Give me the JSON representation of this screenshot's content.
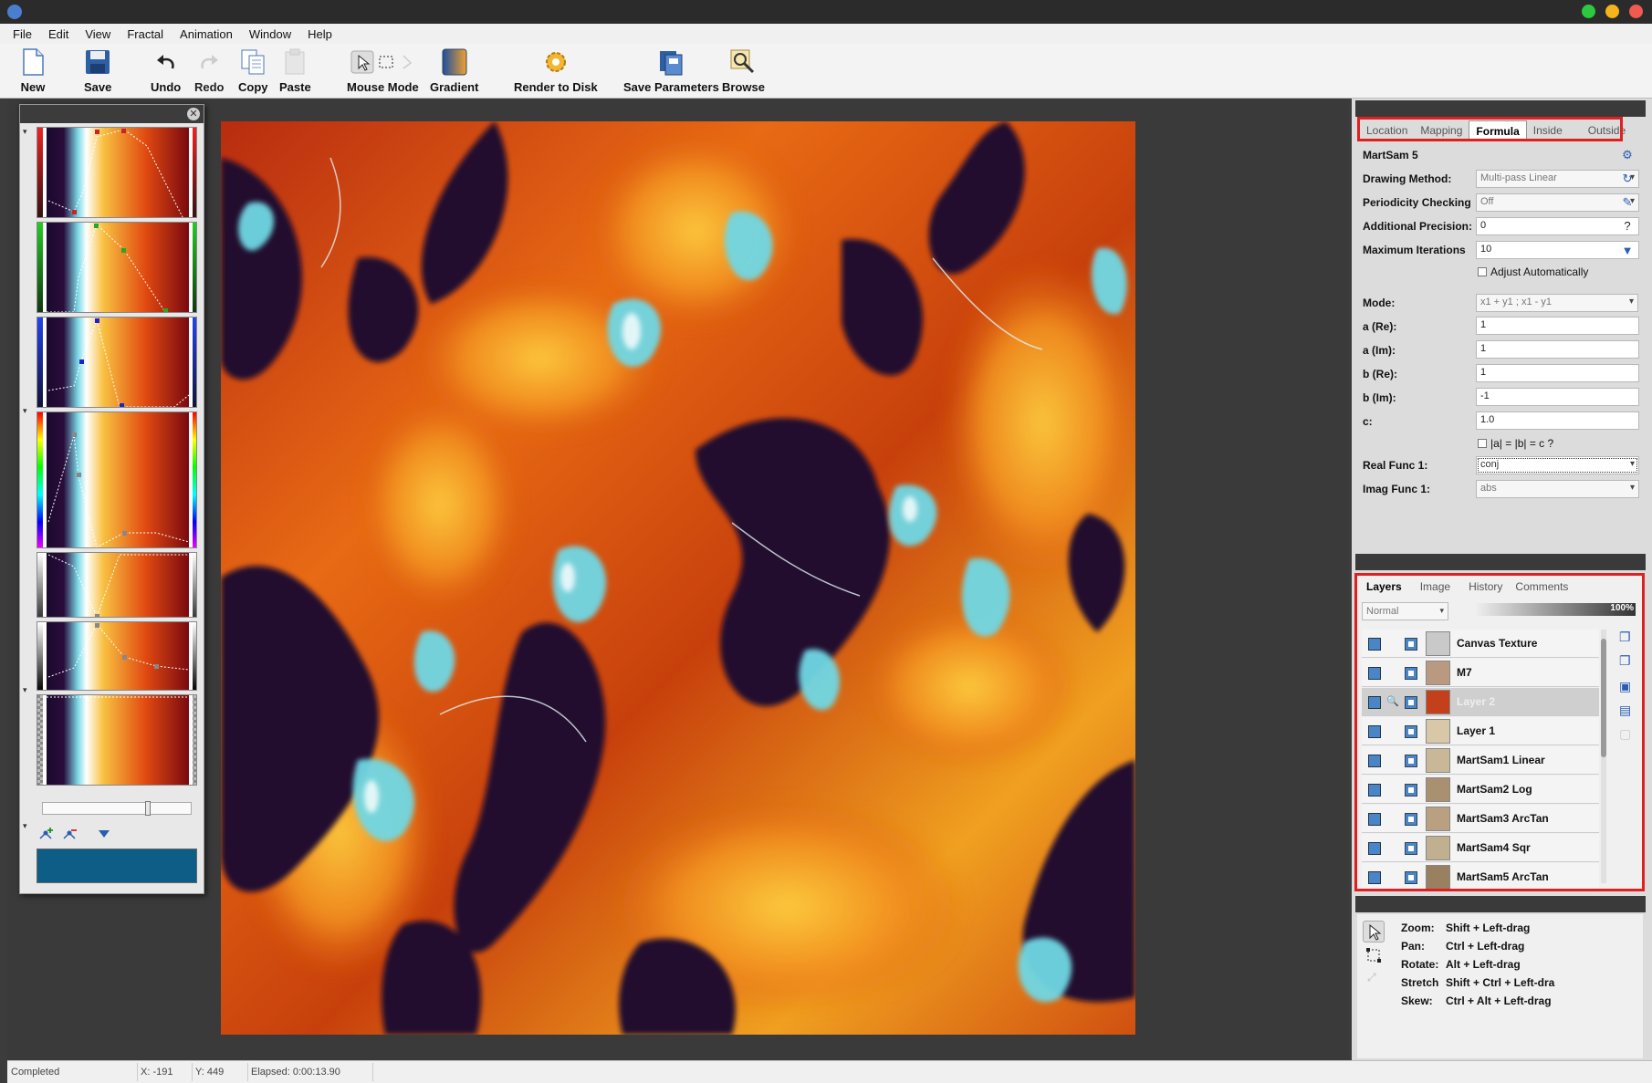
{
  "menu": [
    "File",
    "Edit",
    "View",
    "Fractal",
    "Animation",
    "Window",
    "Help"
  ],
  "toolbar": {
    "new": "New",
    "save": "Save",
    "undo": "Undo",
    "redo": "Redo",
    "copy": "Copy",
    "paste": "Paste",
    "mouse_mode": "Mouse Mode",
    "gradient": "Gradient",
    "render_to_disk": "Render to Disk",
    "save_parameters": "Save Parameters",
    "browse": "Browse"
  },
  "layer_properties": {
    "tabs": [
      "Location",
      "Mapping",
      "Formula",
      "Inside",
      "Outside"
    ],
    "active_tab": "Formula",
    "formula_name": "MartSam 5",
    "drawing_method_label": "Drawing Method:",
    "drawing_method_value": "Multi-pass Linear",
    "periodicity_label": "Periodicity Checking",
    "periodicity_value": "Off",
    "precision_label": "Additional Precision:",
    "precision_value": "0",
    "max_iter_label": "Maximum Iterations",
    "max_iter_value": "10",
    "adjust_auto_label": "Adjust Automatically",
    "mode_label": "Mode:",
    "mode_value": "x1 + y1 ; x1 - y1",
    "a_re_label": "a (Re):",
    "a_re_value": "1",
    "a_im_label": "a (Im):",
    "a_im_value": "1",
    "b_re_label": "b (Re):",
    "b_re_value": "1",
    "b_im_label": "b (Im):",
    "b_im_value": "-1",
    "c_label": "c:",
    "c_value": "1.0",
    "abc_check_label": "|a| = |b| = c ?",
    "real_func_label": "Real Func 1:",
    "real_func_value": "conj",
    "imag_func_label": "Imag Func 1:",
    "imag_func_value": "abs"
  },
  "fractal_properties": {
    "tabs": [
      "Layers",
      "Image",
      "History",
      "Comments"
    ],
    "active_tab": "Layers",
    "blend_mode": "Normal",
    "opacity": "100%",
    "layers": [
      {
        "name": "Canvas Texture",
        "selected": false
      },
      {
        "name": "M7",
        "selected": false
      },
      {
        "name": "Layer 2",
        "selected": true
      },
      {
        "name": "Layer 1",
        "selected": false
      },
      {
        "name": "MartSam1 Linear",
        "selected": false
      },
      {
        "name": "MartSam2 Log",
        "selected": false
      },
      {
        "name": "MartSam3 ArcTan",
        "selected": false
      },
      {
        "name": "MartSam4 Sqr",
        "selected": false
      },
      {
        "name": "MartSam5 ArcTan",
        "selected": false
      }
    ]
  },
  "fractal_mode": {
    "rows": [
      {
        "key": "Zoom:",
        "value": "Shift + Left-drag"
      },
      {
        "key": "Pan:",
        "value": "Ctrl + Left-drag"
      },
      {
        "key": "Rotate:",
        "value": "Alt + Left-drag"
      },
      {
        "key": "Stretch",
        "value": "Shift + Ctrl + Left-dra"
      },
      {
        "key": "Skew:",
        "value": "Ctrl + Alt + Left-drag"
      }
    ]
  },
  "status": {
    "state": "Completed",
    "x": "X: -191",
    "y": "Y: 449",
    "elapsed": "Elapsed: 0:00:13.90"
  },
  "colors": {
    "accent_box": "#e02020",
    "swatch": "#0e5d87",
    "layer_icon": "#4a85c8"
  }
}
